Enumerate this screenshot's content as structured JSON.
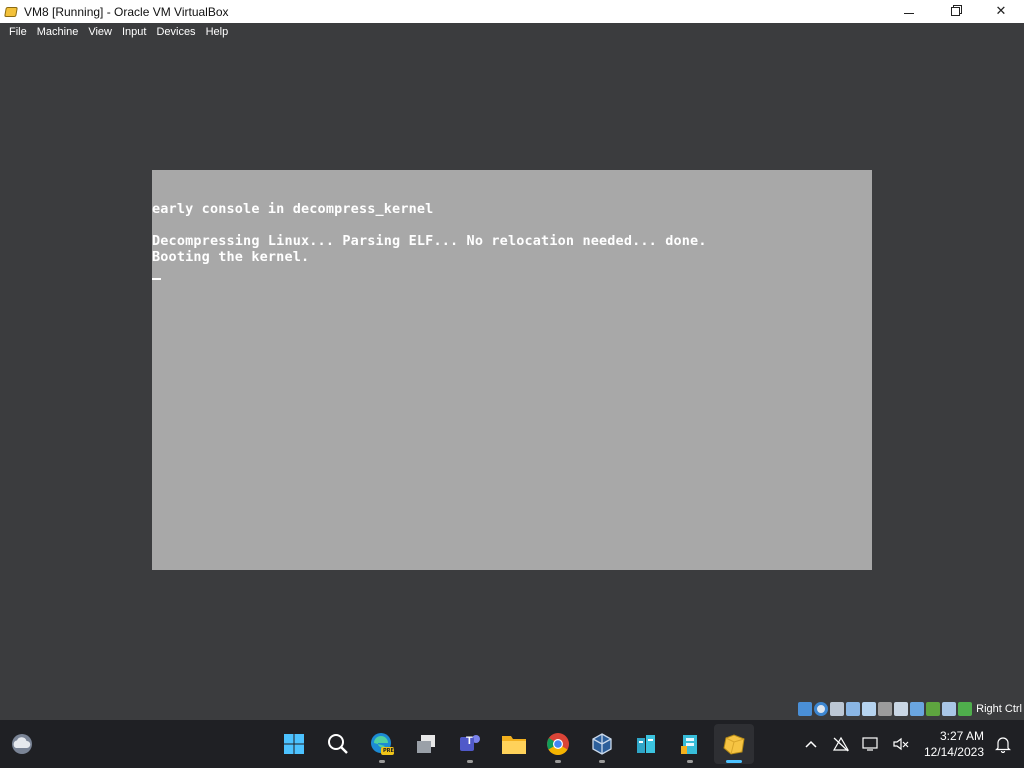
{
  "window": {
    "title": "VM8 [Running] - Oracle VM VirtualBox",
    "controls": {
      "minimize": "minimize",
      "maximize": "maximize",
      "close": "✕"
    }
  },
  "menubar": {
    "items": [
      {
        "label": "File"
      },
      {
        "label": "Machine"
      },
      {
        "label": "View"
      },
      {
        "label": "Input"
      },
      {
        "label": "Devices"
      },
      {
        "label": "Help"
      }
    ]
  },
  "console": {
    "lines": [
      "early console in decompress_kernel",
      "Decompressing Linux... Parsing ELF... No relocation needed... done.",
      "Booting the kernel."
    ]
  },
  "statusbar": {
    "host_key_label": "Right Ctrl",
    "icons": [
      "hard-disk-icon",
      "optical-drive-icon",
      "audio-icon",
      "network-icon",
      "usb-icon",
      "shared-folders-icon",
      "display-icon",
      "recording-icon",
      "cpu-icon",
      "mouse-integration-icon",
      "keyboard-icon"
    ]
  },
  "taskbar": {
    "apps": [
      {
        "name": "start-button",
        "active": false
      },
      {
        "name": "search-button",
        "active": false
      },
      {
        "name": "edge-preview-app",
        "badge": "PRE",
        "active": false
      },
      {
        "name": "task-view-app",
        "active": false
      },
      {
        "name": "teams-app",
        "letter": "T",
        "active": false
      },
      {
        "name": "file-explorer-app",
        "active": false
      },
      {
        "name": "chrome-app",
        "active": false
      },
      {
        "name": "virtualbox-manager-app",
        "active": false
      },
      {
        "name": "database-app",
        "active": false
      },
      {
        "name": "database-app-2",
        "active": false
      },
      {
        "name": "virtualbox-vm-app",
        "active": true
      }
    ],
    "clock": {
      "time": "3:27 AM",
      "date": "12/14/2023"
    }
  },
  "colors": {
    "background": "#3b3c3e",
    "vm_screen": "#a8a8a8",
    "taskbar": "#1f2024",
    "accent": "#4cc2ff"
  }
}
